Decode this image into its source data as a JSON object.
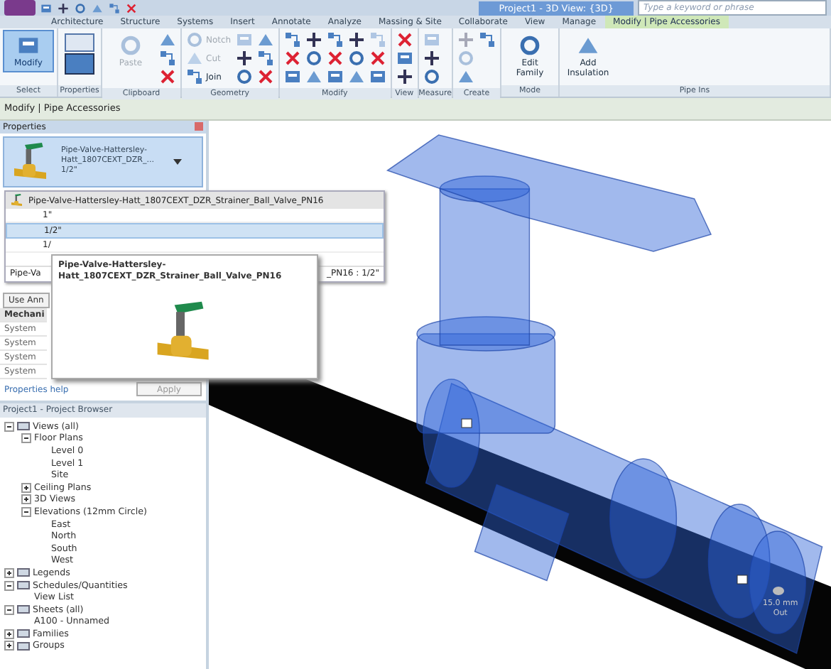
{
  "window": {
    "title": "Project1 - 3D View: {3D}"
  },
  "search": {
    "placeholder": "Type a keyword or phrase"
  },
  "ribbon_tabs": [
    {
      "label": "Architecture",
      "selected": false
    },
    {
      "label": "Structure",
      "selected": false
    },
    {
      "label": "Systems",
      "selected": false
    },
    {
      "label": "Insert",
      "selected": false
    },
    {
      "label": "Annotate",
      "selected": false
    },
    {
      "label": "Analyze",
      "selected": false
    },
    {
      "label": "Massing & Site",
      "selected": false
    },
    {
      "label": "Collaborate",
      "selected": false
    },
    {
      "label": "View",
      "selected": false
    },
    {
      "label": "Manage",
      "selected": false
    },
    {
      "label": "Modify | Pipe Accessories",
      "selected": true
    }
  ],
  "ribbon_panels": [
    {
      "label": "Select",
      "tools": [
        {
          "kind": "large",
          "label": "Modify",
          "selected": true,
          "disabled": false
        }
      ]
    },
    {
      "label": "Properties",
      "tools": [
        {
          "kind": "large-icon",
          "disabled": false
        }
      ]
    },
    {
      "label": "Clipboard",
      "tools": [
        {
          "kind": "large",
          "label": "Paste",
          "disabled": true
        },
        {
          "kind": "icon",
          "disabled": false
        },
        {
          "kind": "icon",
          "disabled": false
        },
        {
          "kind": "icon",
          "disabled": false
        }
      ]
    },
    {
      "label": "Geometry",
      "tools": [
        {
          "kind": "small",
          "label": "Notch",
          "disabled": true
        },
        {
          "kind": "small",
          "label": "Cut",
          "disabled": true
        },
        {
          "kind": "small",
          "label": "Join",
          "disabled": false
        },
        {
          "kind": "icon",
          "disabled": true
        },
        {
          "kind": "icon",
          "disabled": false
        },
        {
          "kind": "icon",
          "disabled": false
        },
        {
          "kind": "icon",
          "disabled": false
        },
        {
          "kind": "icon",
          "disabled": false
        },
        {
          "kind": "icon",
          "disabled": false
        }
      ]
    },
    {
      "label": "Modify",
      "tools": [
        {
          "kind": "icon",
          "disabled": false
        },
        {
          "kind": "icon",
          "disabled": false
        },
        {
          "kind": "icon",
          "disabled": false
        },
        {
          "kind": "icon",
          "disabled": false
        },
        {
          "kind": "icon",
          "disabled": false
        },
        {
          "kind": "icon",
          "disabled": false
        },
        {
          "kind": "icon",
          "disabled": false
        },
        {
          "kind": "icon",
          "disabled": false
        },
        {
          "kind": "icon",
          "disabled": false
        },
        {
          "kind": "icon",
          "disabled": false
        },
        {
          "kind": "icon",
          "disabled": false
        },
        {
          "kind": "icon",
          "disabled": false
        },
        {
          "kind": "icon",
          "disabled": true
        },
        {
          "kind": "icon",
          "disabled": false
        },
        {
          "kind": "icon",
          "disabled": false
        }
      ]
    },
    {
      "label": "View",
      "tools": [
        {
          "kind": "icon",
          "disabled": false
        },
        {
          "kind": "icon",
          "disabled": false
        },
        {
          "kind": "icon",
          "disabled": false
        }
      ]
    },
    {
      "label": "Measure",
      "tools": [
        {
          "kind": "icon",
          "disabled": true
        },
        {
          "kind": "icon",
          "disabled": false
        },
        {
          "kind": "icon",
          "disabled": false
        }
      ]
    },
    {
      "label": "Create",
      "tools": [
        {
          "kind": "icon",
          "disabled": true
        },
        {
          "kind": "icon",
          "disabled": true
        },
        {
          "kind": "icon",
          "disabled": false
        },
        {
          "kind": "icon",
          "disabled": false
        }
      ]
    },
    {
      "label": "Mode",
      "tools": [
        {
          "kind": "large",
          "label": "Edit Family",
          "disabled": false
        }
      ]
    },
    {
      "label": "Pipe Ins",
      "tools": [
        {
          "kind": "large",
          "label": "Add Insulation",
          "disabled": false
        }
      ]
    }
  ],
  "options_bar": {
    "label": "Modify | Pipe Accessories"
  },
  "properties": {
    "title": "Properties",
    "type_name": "Pipe-Valve-Hattersley-Hatt_1807CEXT_DZR_...",
    "type_size": "1/2\"",
    "rows": [
      {
        "kind": "button",
        "label": "Use Ann"
      },
      {
        "kind": "group",
        "label": "Mechani"
      },
      {
        "kind": "param",
        "label": "System"
      },
      {
        "kind": "param",
        "label": "System"
      },
      {
        "kind": "param",
        "label": "System"
      },
      {
        "kind": "param",
        "label": "System"
      }
    ],
    "help_link": "Properties help",
    "apply_button": "Apply"
  },
  "type_dropdown": {
    "family": "Pipe-Valve-Hattersley-Hatt_1807CEXT_DZR_Strainer_Ball_Valve_PN16",
    "types": [
      {
        "label": "1\"",
        "selected": false
      },
      {
        "label": "1/2\"",
        "selected": true
      },
      {
        "label": "1/",
        "selected": false
      }
    ],
    "footer_left": "Pipe-Va",
    "footer_right": "_PN16 : 1/2\""
  },
  "tooltip": {
    "title": "Pipe-Valve-Hattersley-Hatt_1807CEXT_DZR_Strainer_Ball_Valve_PN16"
  },
  "browser": {
    "title": "Project1 - Project Browser",
    "tree": [
      {
        "label": "Views (all)",
        "expanded": true,
        "children": [
          {
            "label": "Floor Plans",
            "expanded": true,
            "children": [
              {
                "label": "Level 0"
              },
              {
                "label": "Level 1"
              },
              {
                "label": "Site"
              }
            ]
          },
          {
            "label": "Ceiling Plans",
            "expanded": false
          },
          {
            "label": "3D Views",
            "expanded": false
          },
          {
            "label": "Elevations (12mm Circle)",
            "expanded": true,
            "children": [
              {
                "label": "East"
              },
              {
                "label": "North"
              },
              {
                "label": "South"
              },
              {
                "label": "West"
              }
            ]
          }
        ]
      },
      {
        "label": "Legends",
        "expanded": false
      },
      {
        "label": "Schedules/Quantities",
        "expanded": true,
        "children": [
          {
            "label": "View List"
          }
        ]
      },
      {
        "label": "Sheets (all)",
        "expanded": true,
        "children": [
          {
            "label": "A100 - Unnamed"
          }
        ]
      },
      {
        "label": "Families",
        "expanded": false
      },
      {
        "label": "Groups",
        "expanded": false
      }
    ]
  },
  "view": {
    "connector_size": "15.0 mm",
    "connector_flow": "Out"
  }
}
